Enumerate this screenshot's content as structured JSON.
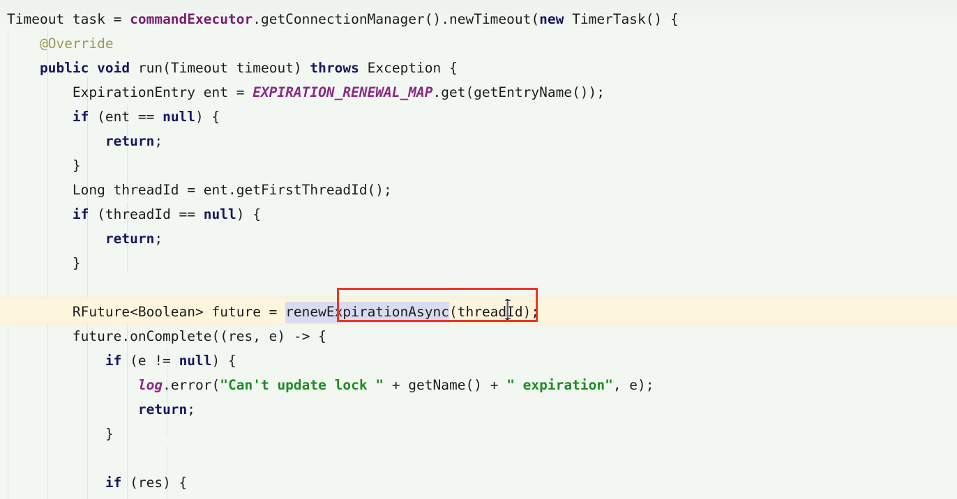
{
  "editor": {
    "kind": "java-source-code-editor",
    "background_color": "#f2f7f2",
    "current_line_color": "#fdf6dc",
    "selection_color": "#d9dcf0",
    "annotation_box_color": "#ee3524",
    "caret_color": "#111111",
    "indent_guide_color": "#dde6dd",
    "font_size_px": 19.5,
    "line_height_px": 35
  },
  "selection": {
    "selected_text": "renewExpirationAsync",
    "caret_char_index": 14
  },
  "code_lines": [
    {
      "indent": 0,
      "tokens": [
        {
          "text": "Timeout task = ",
          "style": "plain"
        },
        {
          "text": "commandExecutor",
          "style": "field"
        },
        {
          "text": ".getConnectionManager().newTimeout(",
          "style": "plain"
        },
        {
          "text": "new",
          "style": "kw"
        },
        {
          "text": " TimerTask() {",
          "style": "plain"
        }
      ]
    },
    {
      "indent": 1,
      "tokens": [
        {
          "text": "@Override",
          "style": "anno"
        }
      ]
    },
    {
      "indent": 1,
      "tokens": [
        {
          "text": "public",
          "style": "kw"
        },
        {
          "text": " ",
          "style": "plain"
        },
        {
          "text": "void",
          "style": "kw"
        },
        {
          "text": " run(Timeout timeout) ",
          "style": "plain"
        },
        {
          "text": "throws",
          "style": "kw"
        },
        {
          "text": " Exception {",
          "style": "plain"
        }
      ]
    },
    {
      "indent": 2,
      "tokens": [
        {
          "text": "ExpirationEntry ent = ",
          "style": "plain"
        },
        {
          "text": "EXPIRATION_RENEWAL_MAP",
          "style": "constf"
        },
        {
          "text": ".get(getEntryName());",
          "style": "plain"
        }
      ]
    },
    {
      "indent": 2,
      "tokens": [
        {
          "text": "if",
          "style": "kw"
        },
        {
          "text": " (ent == ",
          "style": "plain"
        },
        {
          "text": "null",
          "style": "kw"
        },
        {
          "text": ") {",
          "style": "plain"
        }
      ]
    },
    {
      "indent": 3,
      "tokens": [
        {
          "text": "return",
          "style": "kw"
        },
        {
          "text": ";",
          "style": "plain"
        }
      ]
    },
    {
      "indent": 2,
      "tokens": [
        {
          "text": "}",
          "style": "plain"
        }
      ]
    },
    {
      "indent": 2,
      "tokens": [
        {
          "text": "Long threadId = ent.getFirstThreadId();",
          "style": "plain"
        }
      ]
    },
    {
      "indent": 2,
      "tokens": [
        {
          "text": "if",
          "style": "kw"
        },
        {
          "text": " (threadId == ",
          "style": "plain"
        },
        {
          "text": "null",
          "style": "kw"
        },
        {
          "text": ") {",
          "style": "plain"
        }
      ]
    },
    {
      "indent": 3,
      "tokens": [
        {
          "text": "return",
          "style": "kw"
        },
        {
          "text": ";",
          "style": "plain"
        }
      ]
    },
    {
      "indent": 2,
      "tokens": [
        {
          "text": "}",
          "style": "plain"
        }
      ]
    },
    {
      "indent": 0,
      "tokens": [
        {
          "text": "",
          "style": "plain"
        }
      ]
    },
    {
      "indent": 2,
      "current": true,
      "tokens": [
        {
          "text": "RFuture<Boolean> future = ",
          "style": "plain"
        },
        {
          "text": "renewExpirationAsync",
          "style": "plain",
          "selected": true
        },
        {
          "text": "(threadId);",
          "style": "plain"
        }
      ]
    },
    {
      "indent": 2,
      "tokens": [
        {
          "text": "future.onComplete((res, e) -> {",
          "style": "plain"
        }
      ]
    },
    {
      "indent": 3,
      "tokens": [
        {
          "text": "if",
          "style": "kw"
        },
        {
          "text": " (e != ",
          "style": "plain"
        },
        {
          "text": "null",
          "style": "kw"
        },
        {
          "text": ") {",
          "style": "plain"
        }
      ]
    },
    {
      "indent": 4,
      "tokens": [
        {
          "text": "log",
          "style": "logf"
        },
        {
          "text": ".error(",
          "style": "plain"
        },
        {
          "text": "\"Can't update lock \"",
          "style": "str"
        },
        {
          "text": " + getName() + ",
          "style": "plain"
        },
        {
          "text": "\" expiration\"",
          "style": "str"
        },
        {
          "text": ", e);",
          "style": "plain"
        }
      ]
    },
    {
      "indent": 4,
      "tokens": [
        {
          "text": "return",
          "style": "kw"
        },
        {
          "text": ";",
          "style": "plain"
        }
      ]
    },
    {
      "indent": 3,
      "tokens": [
        {
          "text": "}",
          "style": "plain"
        }
      ]
    },
    {
      "indent": 0,
      "tokens": [
        {
          "text": "",
          "style": "plain"
        }
      ]
    },
    {
      "indent": 3,
      "tokens": [
        {
          "text": "if",
          "style": "kw"
        },
        {
          "text": " (res) {",
          "style": "plain"
        }
      ]
    }
  ]
}
